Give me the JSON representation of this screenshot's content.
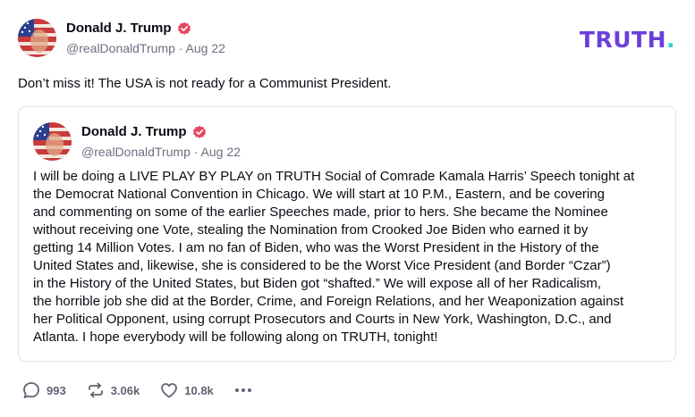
{
  "post": {
    "author_name": "Donald J. Trump",
    "handle_time": "@realDonaldTrump · Aug 22",
    "text": "Don’t miss it! The USA is not ready for a Communist President."
  },
  "brand": {
    "logo_text": "TRUTH",
    "logo_dot": ".",
    "primary_color": "#6c3fd9",
    "dot_color": "#2cd3c4"
  },
  "quote": {
    "author_name": "Donald J. Trump",
    "handle_time": "@realDonaldTrump · Aug 22",
    "lines": [
      "I will be doing a LIVE PLAY BY PLAY on TRUTH Social of Comrade Kamala Harris’ Speech tonight at",
      "the Democrat National Convention in Chicago. We will start at 10 P.M., Eastern, and be covering",
      "and commenting on some of the earlier Speeches made, prior to hers. She became the Nominee",
      "without receiving one Vote, stealing the Nomination from Crooked Joe Biden who earned it by",
      "getting 14 Million Votes. I am no fan of Biden, who was the Worst President in the History of the",
      "United States and, likewise, she is considered to be the Worst Vice President (and Border “Czar”)",
      "in the History of the United States, but Biden got “shafted.” We will expose all of her Radicalism,",
      "the horrible job she did at the Border, Crime, and Foreign Relations, and her Weaponization against",
      "her Political Opponent, using corrupt Prosecutors and Courts in New York, Washington, D.C., and",
      "Atlanta. I hope everybody will be following along on TRUTH, tonight!"
    ]
  },
  "actions": {
    "replies": "993",
    "retruths": "3.06k",
    "likes": "10.8k",
    "reply_icon": "speech-bubble",
    "retruth_icon": "repost-arrows",
    "like_icon": "heart",
    "more_icon": "ellipsis"
  },
  "colors": {
    "verified_badge": "#e5475e",
    "muted_text": "#6b7080",
    "border": "#e3e5ea"
  }
}
